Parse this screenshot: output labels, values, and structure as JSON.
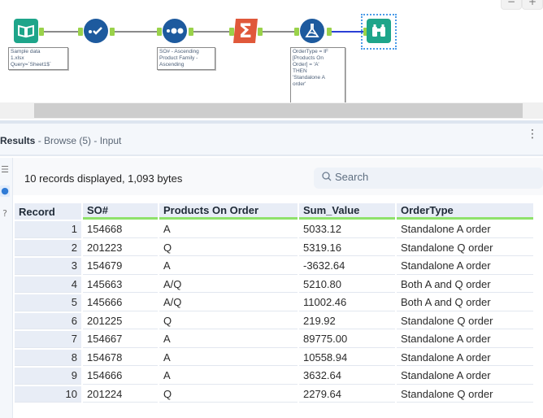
{
  "canvas": {
    "tools": [
      {
        "name": "input-data-tool",
        "icon": "book-icon",
        "annotation": [
          "Sample data",
          "1.xlsx",
          "Query=`Sheet1$`"
        ]
      },
      {
        "name": "select-tool",
        "icon": "checkmark-icon",
        "annotation": []
      },
      {
        "name": "sort-tool",
        "icon": "sort-dots-icon",
        "annotation": [
          "SO# - Ascending",
          "Product Family -",
          "Ascending"
        ]
      },
      {
        "name": "summarize-tool",
        "icon": "sigma-icon",
        "annotation": []
      },
      {
        "name": "formula-tool",
        "icon": "flask-icon",
        "annotation": [
          "OrderType = IF",
          "[Products On",
          "Order] = 'A'",
          "THEN",
          "'Standalone A",
          "order'"
        ]
      },
      {
        "name": "browse-tool",
        "icon": "binoculars-icon",
        "annotation": []
      }
    ],
    "zoom_out_label": "−",
    "zoom_in_label": "+"
  },
  "results": {
    "title": "Results",
    "subtitle": " - Browse (5) - Input",
    "record_info": "10 records displayed, 1,093 bytes",
    "search_placeholder": "Search",
    "columns": [
      "Record",
      "SO#",
      "Products On Order",
      "Sum_Value",
      "OrderType"
    ],
    "rows": [
      [
        "1",
        "154668",
        "A",
        "5033.12",
        "Standalone A order"
      ],
      [
        "2",
        "201223",
        "Q",
        "5319.16",
        "Standalone Q order"
      ],
      [
        "3",
        "154679",
        "A",
        "-3632.64",
        "Standalone A order"
      ],
      [
        "4",
        "145663",
        "A/Q",
        "5210.80",
        "Both A and Q order"
      ],
      [
        "5",
        "145666",
        "A/Q",
        "11002.46",
        "Both A and Q order"
      ],
      [
        "6",
        "201225",
        "Q",
        "219.92",
        "Standalone Q order"
      ],
      [
        "7",
        "154667",
        "A",
        "89775.00",
        "Standalone A order"
      ],
      [
        "8",
        "154678",
        "A",
        "10558.94",
        "Standalone A order"
      ],
      [
        "9",
        "154666",
        "A",
        "3632.64",
        "Standalone A order"
      ],
      [
        "10",
        "201224",
        "Q",
        "2279.64",
        "Standalone Q order"
      ]
    ]
  }
}
